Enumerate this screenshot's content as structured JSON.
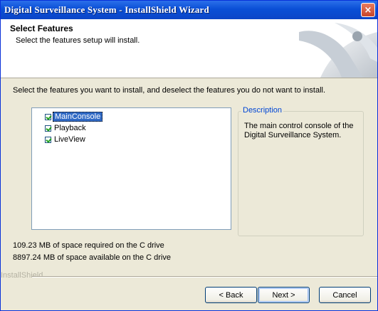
{
  "window": {
    "title": "Digital Surveillance System - InstallShield Wizard",
    "close_glyph": "×"
  },
  "header": {
    "title": "Select Features",
    "subtitle": "Select the features setup will install."
  },
  "instruction": "Select the features you want to install, and deselect the features you do not want to install.",
  "features": [
    {
      "label": "MainConsole",
      "checked": true,
      "selected": true
    },
    {
      "label": "Playback",
      "checked": true,
      "selected": false
    },
    {
      "label": "LiveView",
      "checked": true,
      "selected": false
    }
  ],
  "description": {
    "legend": "Description",
    "text": "The main control console of the Digital Surveillance System."
  },
  "space": {
    "required": "109.23 MB of space required on the C drive",
    "available": "8897.24 MB of space available on the C drive"
  },
  "brand": "InstallShield",
  "buttons": {
    "back": "< Back",
    "next": "Next >",
    "cancel": "Cancel"
  },
  "colors": {
    "titlebar": "#0a4fd6",
    "selection": "#316ac5",
    "dialog_bg": "#ece9d8"
  }
}
